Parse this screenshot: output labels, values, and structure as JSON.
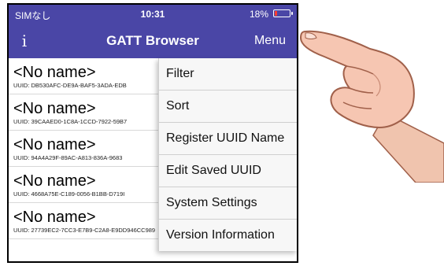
{
  "status": {
    "carrier": "SIMなし",
    "time": "10:31",
    "battery": "18%",
    "battery_level": 0.18
  },
  "navbar": {
    "title": "GATT Browser",
    "menu_label": "Menu",
    "info_icon": "info-icon"
  },
  "devices": [
    {
      "name": "<No name>",
      "uuid": "UUID: DB530AFC-DE9A-BAF5-3ADA-EDB"
    },
    {
      "name": "<No name>",
      "uuid": "UUID: 39CAAED0-1C8A-1CCD-7922-59B7"
    },
    {
      "name": "<No name>",
      "uuid": "UUID: 94A4A29F-89AC-A813-836A-9683"
    },
    {
      "name": "<No name>",
      "uuid": "UUID: 4668A75E-C189-0056-B1BB-D719I"
    },
    {
      "name": "<No name>",
      "uuid": "UUID: 27739EC2-7CC3-E7B9-C2A8-E9DD946CC989"
    }
  ],
  "menu": {
    "items": [
      "Filter",
      "Sort",
      "Register UUID Name",
      "Edit Saved UUID",
      "System Settings",
      "Version Information"
    ]
  },
  "colors": {
    "navbar": "#4a46a6",
    "signal": "#e0245e",
    "battery_low": "#ff3b30"
  }
}
